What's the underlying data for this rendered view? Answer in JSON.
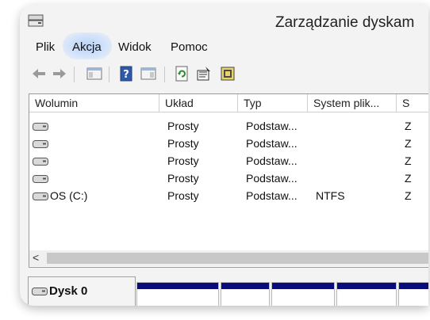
{
  "window": {
    "title": "Zarządzanie dyskam"
  },
  "menu": {
    "items": [
      "Plik",
      "Akcja",
      "Widok",
      "Pomoc"
    ]
  },
  "columns": [
    "Wolumin",
    "Układ",
    "Typ",
    "System plik...",
    "S"
  ],
  "rows": [
    {
      "volume": "",
      "layout": "Prosty",
      "type": "Podstaw...",
      "fs": "",
      "s": "Z"
    },
    {
      "volume": "",
      "layout": "Prosty",
      "type": "Podstaw...",
      "fs": "",
      "s": "Z"
    },
    {
      "volume": "",
      "layout": "Prosty",
      "type": "Podstaw...",
      "fs": "",
      "s": "Z"
    },
    {
      "volume": "",
      "layout": "Prosty",
      "type": "Podstaw...",
      "fs": "",
      "s": "Z"
    },
    {
      "volume": "OS (C:)",
      "layout": "Prosty",
      "type": "Podstaw...",
      "fs": "NTFS",
      "s": "Z"
    }
  ],
  "scrollbar": {
    "left_arrow": "<"
  },
  "disk": {
    "label": "Dysk 0"
  },
  "colors": {
    "partition_bar": "#0a0c7a",
    "menu_highlight": "#b9d3f7"
  },
  "icons": [
    "back-icon",
    "forward-icon",
    "console-tree-icon",
    "help-icon",
    "action-pane-icon",
    "refresh-icon",
    "properties-icon",
    "rescan-disks-icon"
  ]
}
